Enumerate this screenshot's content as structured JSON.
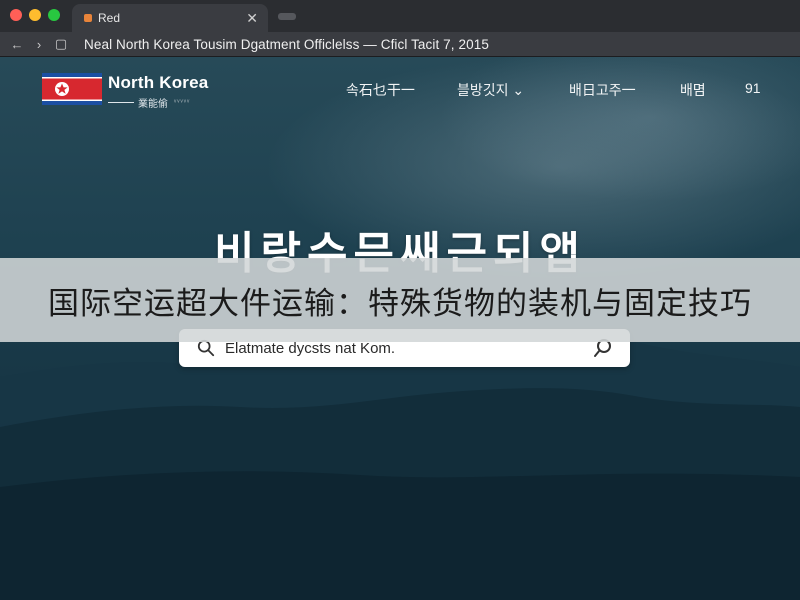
{
  "browser": {
    "tab_title": "Red",
    "tab_close": "✕",
    "url_text": "Neal North Korea Tousim Dgatment Officlelss — Cficl Tacit 7, 2015",
    "nav": {
      "back": "←",
      "forward": "›",
      "reload": "▢"
    }
  },
  "header": {
    "logo_main": "North Korea",
    "logo_sub": "業能偷",
    "logo_small": "ᵛᵛᵛᵛᵛ",
    "nav_items": [
      "속石乜干一",
      "블방깃지 ⌄",
      "배日고주一",
      "배몀",
      "91"
    ]
  },
  "hero": {
    "title": "비랑수믄쌔근되앱",
    "search_placeholder": "Elatmate dycsts nat Kom."
  },
  "overlay": {
    "banner_text": "国际空运超大件运输：特殊货物的装机与固定技巧"
  },
  "colors": {
    "flag_red": "#d7282f",
    "flag_blue": "#1b4fa3",
    "page_bg": "#1e4150"
  }
}
